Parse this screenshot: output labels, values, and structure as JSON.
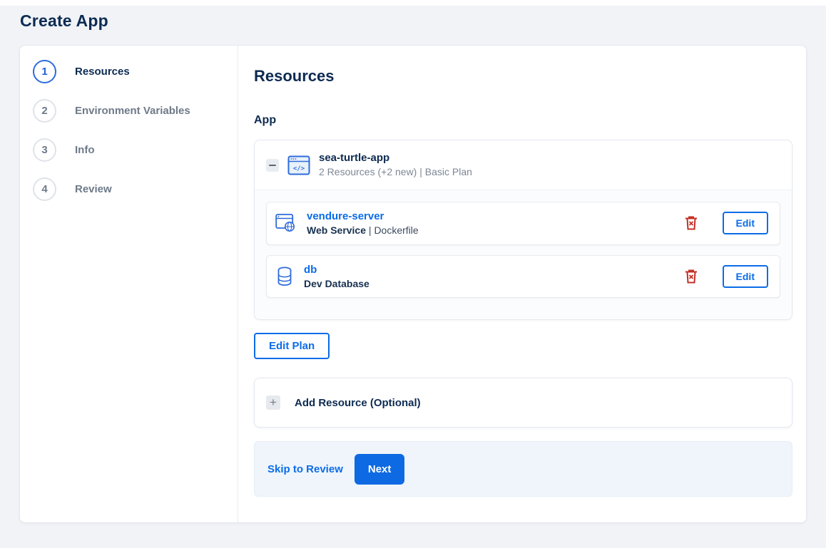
{
  "page": {
    "title": "Create App"
  },
  "colors": {
    "background": "#f1f3f7",
    "accent_blue": "#0b6ce8",
    "navy_text": "#0d2b52",
    "muted_text": "#7d8795",
    "danger_red": "#c33025",
    "footer_bg": "#eff5fb"
  },
  "icons": {
    "app": "app-window-code-icon",
    "web_service": "browser-globe-icon",
    "database": "database-cylinder-icon",
    "delete": "trash-icon",
    "add": "plus-icon",
    "collapse": "minus-icon"
  },
  "steps": [
    {
      "number": "1",
      "label": "Resources",
      "active": true
    },
    {
      "number": "2",
      "label": "Environment Variables",
      "active": false
    },
    {
      "number": "3",
      "label": "Info",
      "active": false
    },
    {
      "number": "4",
      "label": "Review",
      "active": false
    }
  ],
  "content": {
    "heading": "Resources",
    "section_label": "App",
    "app": {
      "name": "sea-turtle-app",
      "summary": "2 Resources (+2 new) | Basic Plan",
      "resources": [
        {
          "name": "vendure-server",
          "type": "Web Service",
          "sep": "|",
          "detail": "Dockerfile",
          "edit_label": "Edit"
        },
        {
          "name": "db",
          "type": "Dev Database",
          "sep": "",
          "detail": "",
          "edit_label": "Edit"
        }
      ]
    },
    "edit_plan_label": "Edit Plan",
    "add_resource_label": "Add Resource (Optional)",
    "footer": {
      "skip_label": "Skip to Review",
      "next_label": "Next"
    }
  }
}
